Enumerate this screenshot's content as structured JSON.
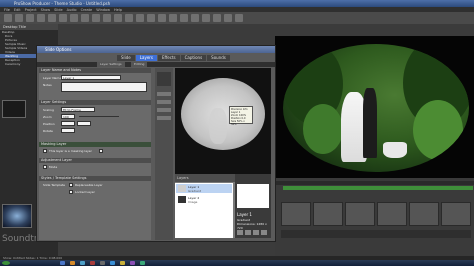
{
  "window": {
    "title": "ProShow Producer - Theme Studio - Untitled.psh"
  },
  "menubar": {
    "items": [
      "File",
      "Edit",
      "Project",
      "Show",
      "Slide",
      "Audio",
      "Create",
      "Window",
      "Help"
    ]
  },
  "left_panel": {
    "header": "Desktop Title",
    "tree": [
      "Desktop",
      "Docs",
      "Pictures",
      "Sample Music",
      "Sample Videos",
      "Videos",
      "Wedding",
      "Reception",
      "Ceremony"
    ],
    "selected_index": 6
  },
  "soundtrack_label": "Soundtrack",
  "dialog": {
    "title": "Slide Options",
    "tabs": [
      "Slide",
      "Layers",
      "Effects",
      "Captions",
      "Sounds"
    ],
    "active_tab": "Layers",
    "subtabs": [
      "Layer Settings",
      "Editing"
    ],
    "sections": {
      "name_notes": "Layer Name and Notes",
      "layer_name_label": "Layer Name",
      "layer_name_value": "Layer 1",
      "notes_label": "Notes",
      "settings": "Layer Settings",
      "scaling_label": "Scaling",
      "scaling_value": "Fit to Frame",
      "zoom_label": "Zoom",
      "zoom_value": "100",
      "position_label": "Position",
      "rotate_label": "Rotate",
      "masking": "Masking Layer",
      "masking_checkbox": "This layer is a masking layer",
      "adjustment": "Adjustment Layer",
      "adjust_checkbox": "Mode",
      "styles": "Styles / Template Settings",
      "slide_template": "Slide Template",
      "replaceable": "Replaceable Layer",
      "locked": "Locked Layer"
    },
    "preview": {
      "tooltip_lines": [
        "Precision Info",
        "Layer 1",
        "Zoom 100%",
        "Position 0,0",
        "Size 50% x 50%"
      ]
    },
    "layers": {
      "header": "Layers",
      "rows": [
        {
          "name": "Layer 1",
          "sub": "Gradient"
        },
        {
          "name": "Layer 2",
          "sub": "Image"
        }
      ],
      "info_title": "Layer 1",
      "info_sub": "Gradient",
      "info_detail": "Dimensions: 1280 x 720"
    }
  },
  "statusbar": {
    "text": "Show: Untitled   Slides: 1   Time: 0:08.000"
  },
  "colors": {
    "accent": "#3e6fd6",
    "title_gradient_top": "#7088b4",
    "panel_dark": "#2b2b2b"
  }
}
